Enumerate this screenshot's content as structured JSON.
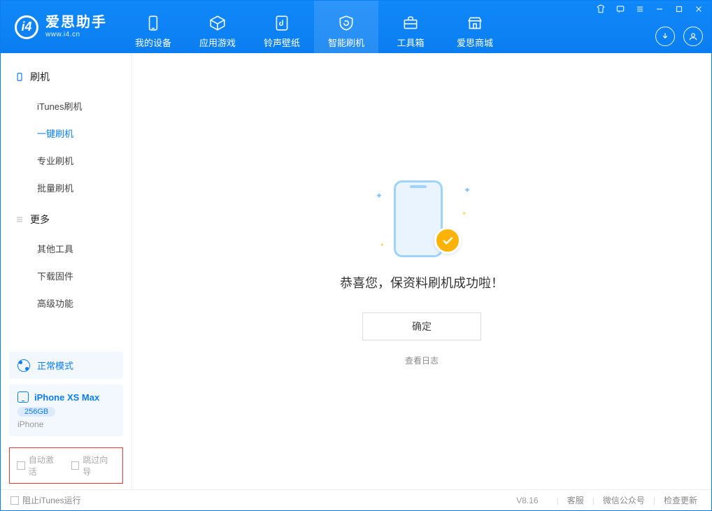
{
  "app": {
    "title": "爱思助手",
    "subtitle": "www.i4.cn"
  },
  "tabs": {
    "device": "我的设备",
    "apps": "应用游戏",
    "ring": "铃声壁纸",
    "flash": "智能刷机",
    "toolbox": "工具箱",
    "store": "爱思商城"
  },
  "sidebar": {
    "group1_title": "刷机",
    "group1": {
      "itunes": "iTunes刷机",
      "oneclick": "一键刷机",
      "pro": "专业刷机",
      "batch": "批量刷机"
    },
    "group2_title": "更多",
    "group2": {
      "other": "其他工具",
      "firmware": "下载固件",
      "advanced": "高级功能"
    },
    "mode": "正常模式",
    "device_name": "iPhone XS Max",
    "device_storage": "256GB",
    "device_type": "iPhone",
    "auto_activate": "自动激活",
    "skip_guide": "跳过向导"
  },
  "main": {
    "message": "恭喜您，保资料刷机成功啦！",
    "ok": "确定",
    "log": "查看日志"
  },
  "status": {
    "block_itunes": "阻止iTunes运行",
    "version": "V8.16",
    "link1": "客服",
    "link2": "微信公众号",
    "link3": "检查更新"
  }
}
